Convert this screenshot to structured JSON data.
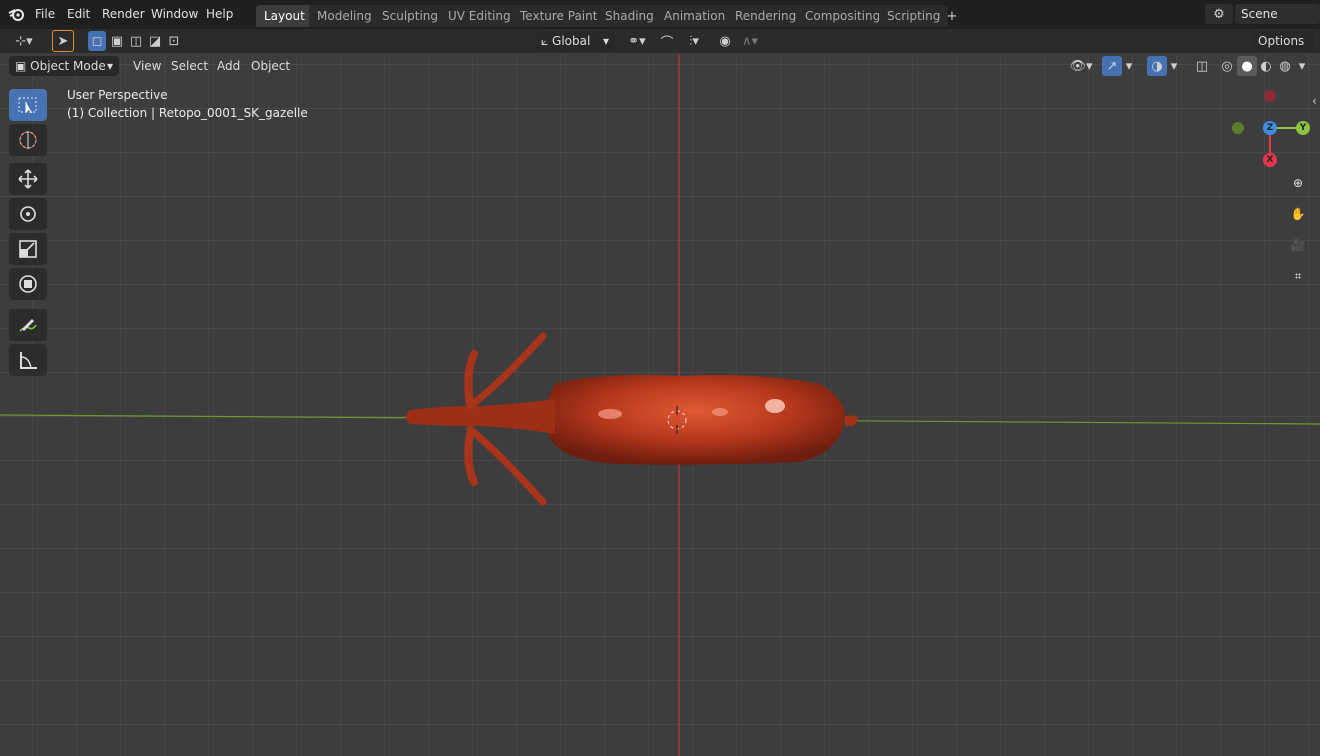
{
  "menu": {
    "items": [
      "File",
      "Edit",
      "Render",
      "Window",
      "Help"
    ]
  },
  "workspace_tabs": [
    "Layout",
    "Modeling",
    "Sculpting",
    "UV Editing",
    "Texture Paint",
    "Shading",
    "Animation",
    "Rendering",
    "Compositing",
    "Scripting"
  ],
  "active_tab": "Layout",
  "scene": {
    "name": "Scene"
  },
  "header": {
    "orientation": "Global",
    "options_label": "Options"
  },
  "viewport_header": {
    "mode": "Object Mode",
    "menus": [
      "View",
      "Select",
      "Add",
      "Object"
    ]
  },
  "overlay": {
    "perspective": "User Perspective",
    "object_info": "(1) Collection | Retopo_0001_SK_gazelle"
  },
  "gizmo": {
    "z": "Z",
    "y": "Y",
    "x": "X"
  },
  "colors": {
    "accent": "#4772b3",
    "x_axis": "#e8344b",
    "y_axis": "#8bc53f",
    "z_axis": "#3b8fe6",
    "model": "#b5371c"
  },
  "icons": {
    "select": "select-box-icon",
    "cursor": "cursor-icon",
    "move": "move-icon",
    "rotate": "rotate-icon",
    "scale": "scale-icon",
    "transform": "transform-icon",
    "annotate": "annotate-icon",
    "measure": "measure-icon"
  }
}
